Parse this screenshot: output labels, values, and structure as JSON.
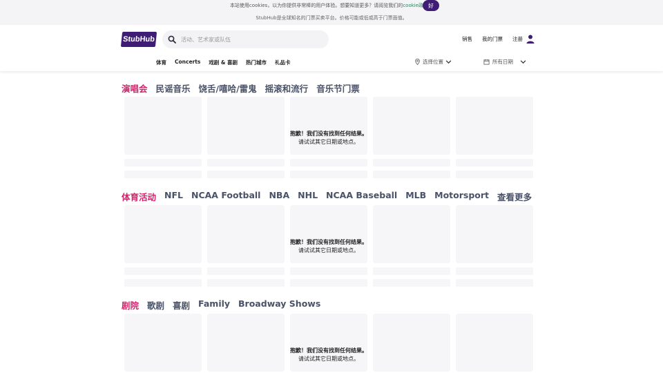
{
  "cookie": {
    "text_before": "本站使用cookies，以为你提供非常棒的用户体验。想要知道更多？请阅览我们的",
    "link": "cookie政策",
    "text_after": "。",
    "ok_label": "好"
  },
  "notice": {
    "text": "StubHub是全球知名的门票买卖平台。价格可能或低或高于门票面值。"
  },
  "header": {
    "logo_text": "StubHub",
    "search_placeholder": "活动、艺术家或队伍",
    "links": {
      "sell": "销售",
      "my_tickets": "我的门票",
      "signup": "注册"
    }
  },
  "nav": {
    "items": [
      "体育",
      "Concerts",
      "戏剧 & 喜剧",
      "热门城市",
      "礼品卡"
    ]
  },
  "filters": {
    "location": "选择位置",
    "date": "所有日期"
  },
  "sections": [
    {
      "categories": [
        "演唱会",
        "民谣音乐",
        "饶舌/嘻哈/雷鬼",
        "摇滚和流行",
        "音乐节门票"
      ]
    },
    {
      "categories": [
        "体育活动",
        "NFL",
        "NCAA Football",
        "NBA",
        "NHL",
        "NCAA Baseball",
        "MLB",
        "Motorsport",
        "查看更多"
      ]
    },
    {
      "categories": [
        "剧院",
        "歌剧",
        "喜剧",
        "Family",
        "Broadway Shows"
      ]
    }
  ],
  "empty_state": {
    "line1": "抱歉！我们没有找到任何结果。",
    "line2": "请试试其它日期或地点。"
  },
  "colors": {
    "brand": "#3f1d74",
    "accent": "#d0246b",
    "link_green": "#2d7f5d"
  }
}
